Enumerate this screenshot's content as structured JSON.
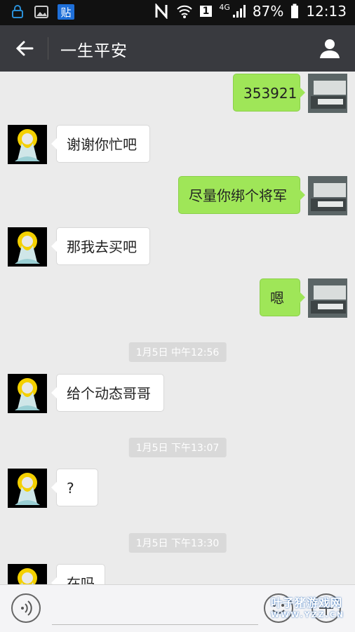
{
  "status_bar": {
    "battery": "87%",
    "time": "12:13",
    "network": "4G",
    "sim_slot": "1",
    "notification_badge": "贴",
    "icons": [
      "lock-sync-icon",
      "image-icon",
      "tieba-icon",
      "nfc-icon",
      "wifi-icon",
      "signal-icon",
      "battery-icon"
    ]
  },
  "header": {
    "title": "一生平安"
  },
  "messages": [
    {
      "side": "out",
      "text": "353921"
    },
    {
      "side": "in",
      "text": "谢谢你忙吧"
    },
    {
      "side": "out",
      "text": "尽量你绑个将军"
    },
    {
      "side": "in",
      "text": "那我去买吧"
    },
    {
      "side": "out",
      "text": "嗯"
    },
    {
      "type": "time",
      "text": "1月5日 中午12:56"
    },
    {
      "side": "in",
      "text": "给个动态哥哥"
    },
    {
      "type": "time",
      "text": "1月5日 下午13:07"
    },
    {
      "side": "in",
      "text": "?"
    },
    {
      "type": "time",
      "text": "1月5日 下午13:30"
    },
    {
      "side": "in",
      "text": "在吗"
    }
  ],
  "input_bar": {
    "placeholder": "",
    "watermark_main": "叶子猪游戏网",
    "watermark_sub": "WWW.YZZ.CN"
  },
  "colors": {
    "titlebar": "#393a3f",
    "chat_bg": "#ebebeb",
    "out_bubble": "#9fe658",
    "in_bubble": "#ffffff"
  }
}
